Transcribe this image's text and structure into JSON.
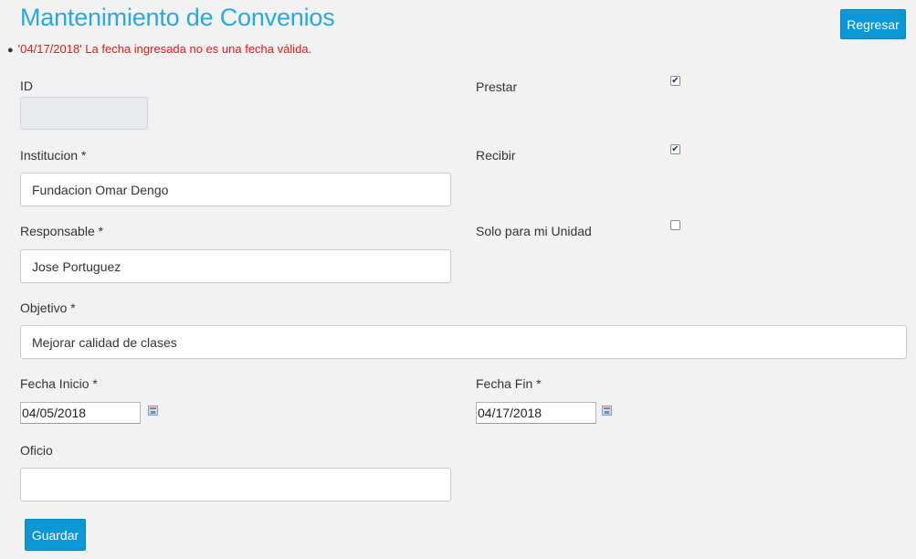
{
  "page": {
    "title": "Mantenimiento de Convenios"
  },
  "header": {
    "back_button": "Regresar"
  },
  "error": {
    "message": "'04/17/2018' La fecha ingresada no es una fecha válida."
  },
  "form": {
    "id": {
      "label": "ID",
      "value": ""
    },
    "institucion": {
      "label": "Institucion *",
      "value": "Fundacion Omar Dengo"
    },
    "responsable": {
      "label": "Responsable *",
      "value": "Jose Portuguez"
    },
    "objetivo": {
      "label": "Objetivo *",
      "value": "Mejorar calidad de clases"
    },
    "fecha_inicio": {
      "label": "Fecha Inicio *",
      "value": "04/05/2018"
    },
    "fecha_fin": {
      "label": "Fecha Fin *",
      "value": "04/17/2018"
    },
    "oficio": {
      "label": "Oficio",
      "value": ""
    },
    "prestar": {
      "label": "Prestar",
      "checked": true
    },
    "recibir": {
      "label": "Recibir",
      "checked": true
    },
    "solo_unidad": {
      "label": "Solo para mi Unidad",
      "checked": false
    },
    "save_button": "Guardar"
  },
  "icons": {
    "calendar": "calendar-icon",
    "check": "checkmark-icon"
  }
}
